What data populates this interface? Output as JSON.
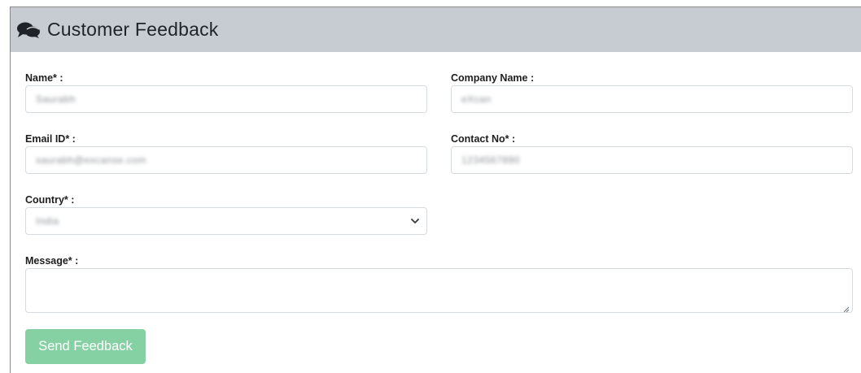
{
  "header": {
    "title": "Customer Feedback",
    "icon": "comments-icon"
  },
  "form": {
    "name": {
      "label": "Name* :",
      "value": "Saurabh"
    },
    "company": {
      "label": "Company Name :",
      "value": "eXcan"
    },
    "email": {
      "label": "Email ID* :",
      "value": "saurabh@excanse.com"
    },
    "contact": {
      "label": "Contact No* :",
      "value": "1234567890"
    },
    "country": {
      "label": "Country* :",
      "value": "India"
    },
    "message": {
      "label": "Message* :",
      "value": ""
    },
    "submit_label": "Send Feedback"
  },
  "colors": {
    "header_bg": "#c7ccd3",
    "button_bg": "#85d1a4",
    "border": "#d6dbe0"
  }
}
